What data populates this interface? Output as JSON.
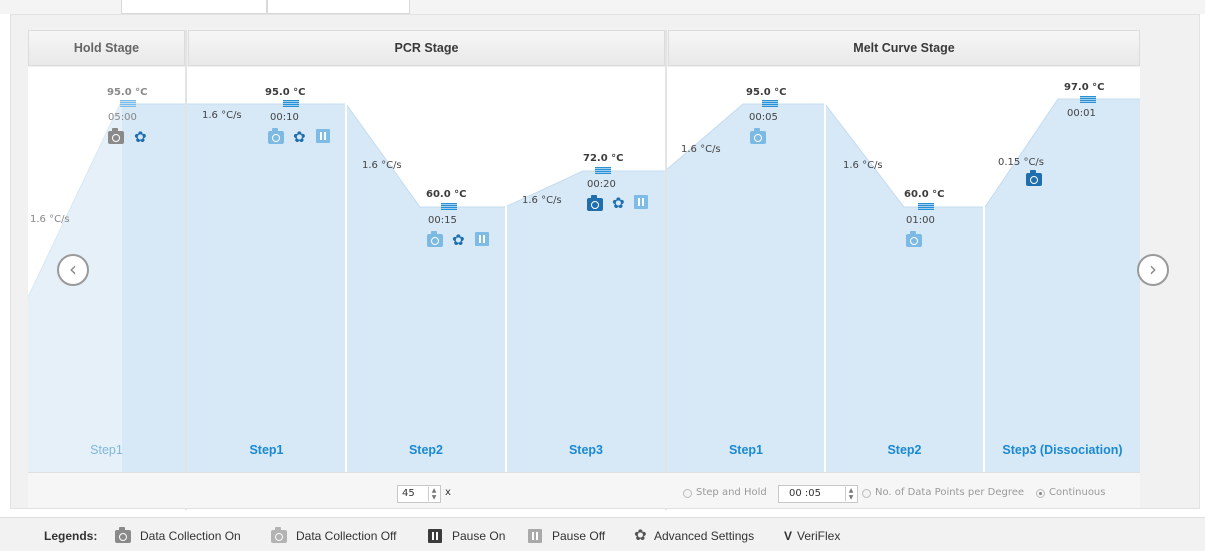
{
  "stages": {
    "hold": "Hold Stage",
    "pcr": "PCR Stage",
    "melt": "Melt Curve Stage"
  },
  "steps": {
    "hold_step1": {
      "label": "Step1",
      "temp": "95.0 °C",
      "time": "05:00",
      "rate": "1.6 °C/s"
    },
    "pcr_step1": {
      "label": "Step1",
      "temp": "95.0 °C",
      "time": "00:10",
      "rate": "1.6 °C/s"
    },
    "pcr_step2": {
      "label": "Step2",
      "temp": "60.0 °C",
      "time": "00:15",
      "rate": "1.6 °C/s"
    },
    "pcr_step3": {
      "label": "Step3",
      "temp": "72.0 °C",
      "time": "00:20",
      "rate": "1.6 °C/s"
    },
    "melt_step1": {
      "label": "Step1",
      "temp": "95.0 °C",
      "time": "00:05",
      "rate": "1.6 °C/s"
    },
    "melt_step2": {
      "label": "Step2",
      "temp": "60.0 °C",
      "time": "01:00",
      "rate": "1.6 °C/s"
    },
    "melt_step3": {
      "label": "Step3 (Dissociation)",
      "temp": "97.0 °C",
      "time": "00:01",
      "rate": "0.15 °C/s"
    }
  },
  "pcr_cycles": {
    "value": "45",
    "suffix": "x"
  },
  "melt_options": {
    "step_and_hold": "Step and Hold",
    "hold_time": "00 :05",
    "points_per_degree": "No. of Data Points per Degree",
    "continuous": "Continuous",
    "selected": "Continuous"
  },
  "legend": {
    "title": "Legends:",
    "data_collection_on": "Data Collection On",
    "data_collection_off": "Data Collection Off",
    "pause_on": "Pause On",
    "pause_off": "Pause Off",
    "advanced_settings": "Advanced Settings",
    "veriflex_symbol": "V",
    "veriflex": "VeriFlex"
  },
  "icons": {
    "nav_prev": "chevron-left-circle-icon",
    "nav_next": "chevron-right-circle-icon",
    "camera": "camera-icon",
    "gear": "gear-icon",
    "pause": "pause-icon"
  },
  "colors": {
    "fill": "#d6e8f6",
    "accent": "#1b8ad0",
    "camera_on": "#1f6fae",
    "camera_off": "#7cb9e3"
  }
}
